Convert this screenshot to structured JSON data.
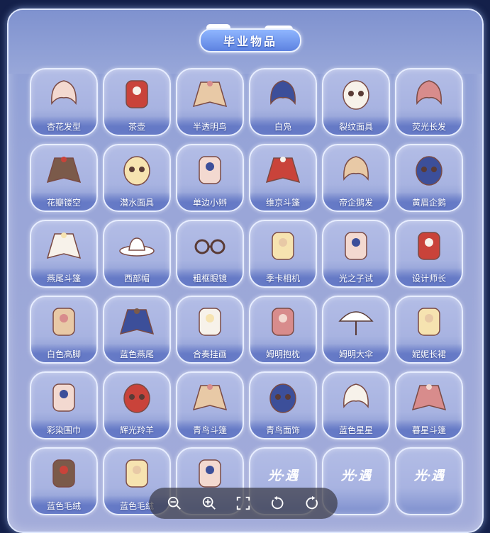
{
  "title": "毕业物品",
  "brand_text": "光·遇",
  "items": [
    {
      "label": "杏花发型",
      "icon": "hair-icon"
    },
    {
      "label": "茶壶",
      "icon": "teapot-icon"
    },
    {
      "label": "半透明鸟",
      "icon": "bird-cape-icon"
    },
    {
      "label": "白凫",
      "icon": "bird-hair-icon"
    },
    {
      "label": "裂纹面具",
      "icon": "cracked-mask-icon"
    },
    {
      "label": "荧光长发",
      "icon": "long-hair-icon"
    },
    {
      "label": "花瓣镂空",
      "icon": "petal-cape-icon"
    },
    {
      "label": "潜水面具",
      "icon": "diving-mask-icon"
    },
    {
      "label": "单边小辫",
      "icon": "braid-icon"
    },
    {
      "label": "维京斗篷",
      "icon": "viking-cape-icon"
    },
    {
      "label": "帝企鹅发",
      "icon": "penguin-hair-icon"
    },
    {
      "label": "黄眉企鹅",
      "icon": "penguin-mask-icon"
    },
    {
      "label": "燕尾斗篷",
      "icon": "swallow-cape-icon"
    },
    {
      "label": "西部帽",
      "icon": "cowboy-hat-icon"
    },
    {
      "label": "粗框眼镜",
      "icon": "glasses-icon"
    },
    {
      "label": "季卡相机",
      "icon": "camera-icon"
    },
    {
      "label": "光之子试",
      "icon": "child-statue-icon"
    },
    {
      "label": "设计师长",
      "icon": "designer-outfit-icon"
    },
    {
      "label": "白色高脚",
      "icon": "piano-icon"
    },
    {
      "label": "蓝色燕尾",
      "icon": "blue-cape-icon"
    },
    {
      "label": "合奏挂画",
      "icon": "painting-icon"
    },
    {
      "label": "姆明抱枕",
      "icon": "moomin-pillow-icon"
    },
    {
      "label": "姆明大伞",
      "icon": "umbrella-icon"
    },
    {
      "label": "妮妮长裙",
      "icon": "dress-icon"
    },
    {
      "label": "彩染围巾",
      "icon": "scarf-icon"
    },
    {
      "label": "辉光羚羊",
      "icon": "antelope-mask-icon"
    },
    {
      "label": "青鸟斗篷",
      "icon": "bluebird-cape-icon"
    },
    {
      "label": "青鸟面饰",
      "icon": "bluebird-mask-icon"
    },
    {
      "label": "蓝色星星",
      "icon": "star-hair-icon"
    },
    {
      "label": "暮星斗篷",
      "icon": "dusk-cape-icon"
    },
    {
      "label": "蓝色毛绒",
      "icon": "boots-icon"
    },
    {
      "label": "蓝色毛绒",
      "icon": "fur-outfit-icon"
    },
    {
      "label": "",
      "icon": "crab-horn-icon"
    },
    {
      "label": "",
      "icon": "sky-logo-icon"
    },
    {
      "label": "",
      "icon": "sky-logo-icon"
    },
    {
      "label": "",
      "icon": "sky-logo-icon"
    }
  ],
  "toolbar": [
    {
      "name": "zoom-out-icon"
    },
    {
      "name": "zoom-in-icon"
    },
    {
      "name": "fullscreen-icon"
    },
    {
      "name": "rotate-left-icon"
    },
    {
      "name": "rotate-right-icon"
    }
  ]
}
